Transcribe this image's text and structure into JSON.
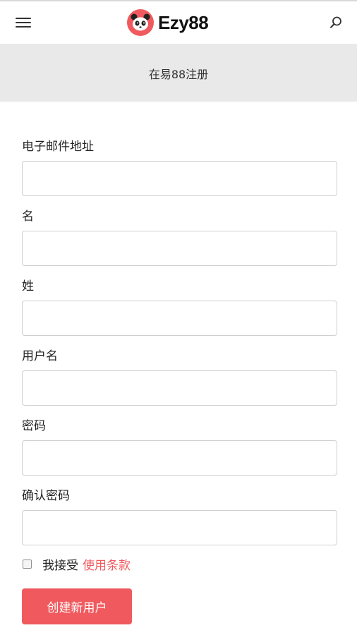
{
  "header": {
    "brand_name": "Ezy88",
    "menu_icon": "hamburger-menu-icon",
    "search_icon": "search-icon",
    "logo_icon": "panda-logo-icon"
  },
  "banner": {
    "title": "在易88注册"
  },
  "form": {
    "fields": [
      {
        "label": "电子邮件地址",
        "value": ""
      },
      {
        "label": "名",
        "value": ""
      },
      {
        "label": "姓",
        "value": ""
      },
      {
        "label": "用户名",
        "value": ""
      },
      {
        "label": "密码",
        "value": ""
      },
      {
        "label": "确认密码",
        "value": ""
      }
    ],
    "terms": {
      "checked": false,
      "text": "我接受",
      "link": "使用条款"
    },
    "submit_label": "创建新用户"
  },
  "colors": {
    "accent": "#f05a5e",
    "banner_bg": "#e9e9e9",
    "input_border": "#cfcfcf"
  }
}
